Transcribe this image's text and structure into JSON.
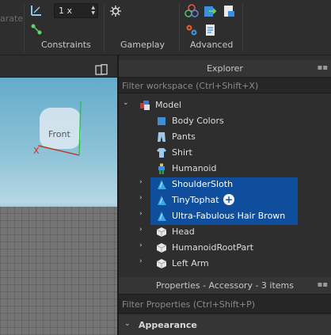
{
  "ribbon": {
    "faded_text": "arate",
    "increment_value": "1 x",
    "groups": {
      "constraints": "Constraints",
      "gameplay": "Gameplay",
      "advanced": "Advanced"
    }
  },
  "viewport": {
    "face_label": "Front",
    "axis_label": "X"
  },
  "explorer": {
    "title": "Explorer",
    "filter_placeholder": "Filter workspace (Ctrl+Shift+X)",
    "tree": [
      {
        "label": "Model",
        "expanded": true,
        "icon": "model-icon",
        "depth": 0
      },
      {
        "label": "Body Colors",
        "icon": "body-colors-icon",
        "depth": 1
      },
      {
        "label": "Pants",
        "icon": "pants-icon",
        "depth": 1
      },
      {
        "label": "Shirt",
        "icon": "shirt-icon",
        "depth": 1
      },
      {
        "label": "Humanoid",
        "icon": "humanoid-icon",
        "depth": 1
      },
      {
        "label": "ShoulderSloth",
        "icon": "accessory-icon",
        "depth": 1,
        "selected": true
      },
      {
        "label": "TinyTophat",
        "icon": "accessory-icon",
        "depth": 1,
        "selected": true
      },
      {
        "label": "Ultra-Fabulous Hair Brown",
        "icon": "accessory-icon",
        "depth": 1,
        "selected": true
      },
      {
        "label": "Head",
        "icon": "part-icon",
        "depth": 1
      },
      {
        "label": "HumanoidRootPart",
        "icon": "part-icon",
        "depth": 1
      },
      {
        "label": "Left Arm",
        "icon": "part-icon",
        "depth": 1
      }
    ]
  },
  "properties": {
    "title": "Properties - Accessory - 3 items",
    "filter_placeholder": "Filter Properties (Ctrl+Shift+P)",
    "section": "Appearance"
  },
  "colors": {
    "selection": "#0f4e9c",
    "panel_bg": "#2e2e2e",
    "accessory_icon": "#38a8e8"
  }
}
